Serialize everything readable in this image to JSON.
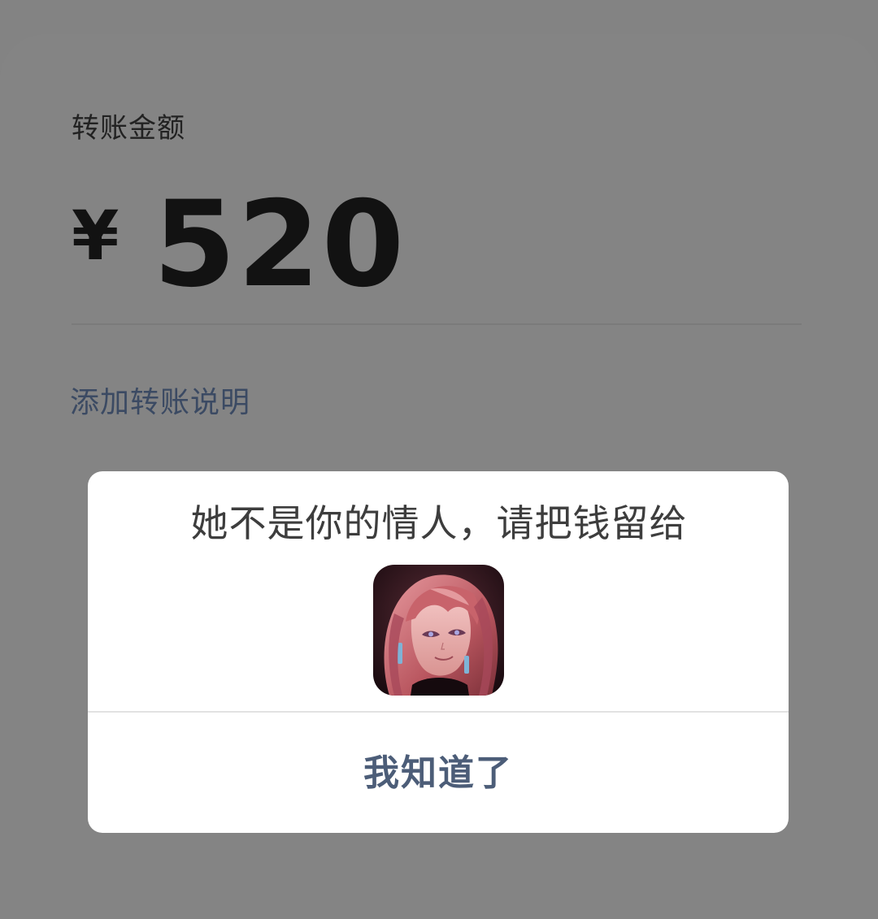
{
  "transfer": {
    "amount_label": "转账金额",
    "currency_symbol": "¥",
    "amount": "520",
    "add_note_label": "添加转账说明"
  },
  "dialog": {
    "message": "她不是你的情人，请把钱留给",
    "avatar_icon": "portrait-avatar-icon",
    "confirm_label": "我知道了"
  },
  "colors": {
    "overlay_gray": "#838383",
    "dialog_bg": "#ffffff",
    "link_blue_gray": "#3b4a63",
    "button_text": "#4c5d78"
  }
}
